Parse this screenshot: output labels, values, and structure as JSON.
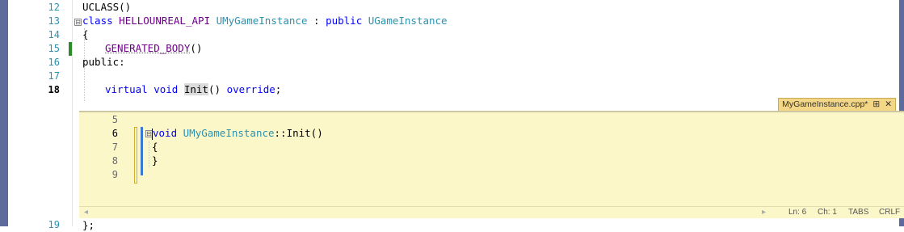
{
  "editor": {
    "line_numbers": [
      "12",
      "13",
      "14",
      "15",
      "16",
      "17",
      "18",
      "19"
    ],
    "lines": {
      "l12": "UCLASS()",
      "l13_kw": "class",
      "l13_api": "HELLOUNREAL_API",
      "l13_name": "UMyGameInstance",
      "l13_sep": " : ",
      "l13_kw2": "public",
      "l13_base": "UGameInstance",
      "l14": "{",
      "l15_macro": "GENERATED_BODY",
      "l15_rest": "()",
      "l16": "public:",
      "l18_kw": "virtual",
      "l18_void": "void",
      "l18_fn": "Init",
      "l18_rest": "()",
      "l18_override": "override",
      "l18_end": ";",
      "l19": "};"
    },
    "fold_glyph": "⊟"
  },
  "peek": {
    "tab_title": "MyGameInstance.cpp*",
    "pin_glyph": "⊞",
    "close_glyph": "✕",
    "line_numbers": [
      "5",
      "6",
      "7",
      "8",
      "9"
    ],
    "lines": {
      "l6_kw": "void",
      "l6_class": "UMyGameInstance",
      "l6_rest": "::Init()",
      "l7": "{",
      "l8": "}"
    },
    "status": {
      "scroll_left": "◂",
      "scroll_right": "▸",
      "ln": "Ln: 6",
      "ch": "Ch: 1",
      "tabs": "TABS",
      "eol": "CRLF"
    }
  }
}
